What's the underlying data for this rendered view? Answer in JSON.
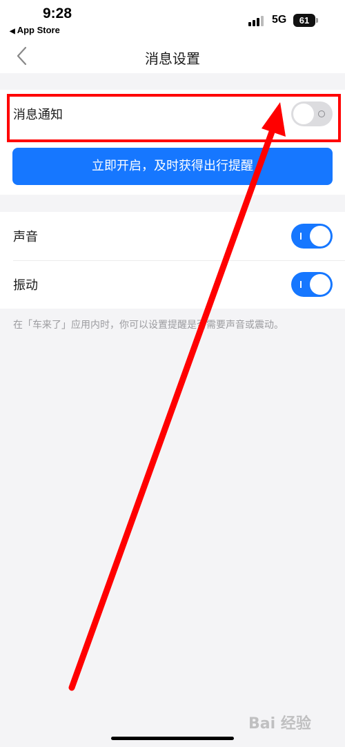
{
  "status_bar": {
    "time": "9:28",
    "back_app": "App Store",
    "network": "5G",
    "battery": "61"
  },
  "nav": {
    "title": "消息设置"
  },
  "notification": {
    "label": "消息通知",
    "enabled": false,
    "enable_button": "立即开启，及时获得出行提醒"
  },
  "settings": {
    "sound_label": "声音",
    "sound_enabled": true,
    "vibration_label": "振动",
    "vibration_enabled": true
  },
  "hint": "在「车来了」应用内时，你可以设置提醒是否需要声音或震动。",
  "watermark": "Bai 经验",
  "colors": {
    "accent": "#1677ff",
    "highlight": "#ff0000"
  }
}
